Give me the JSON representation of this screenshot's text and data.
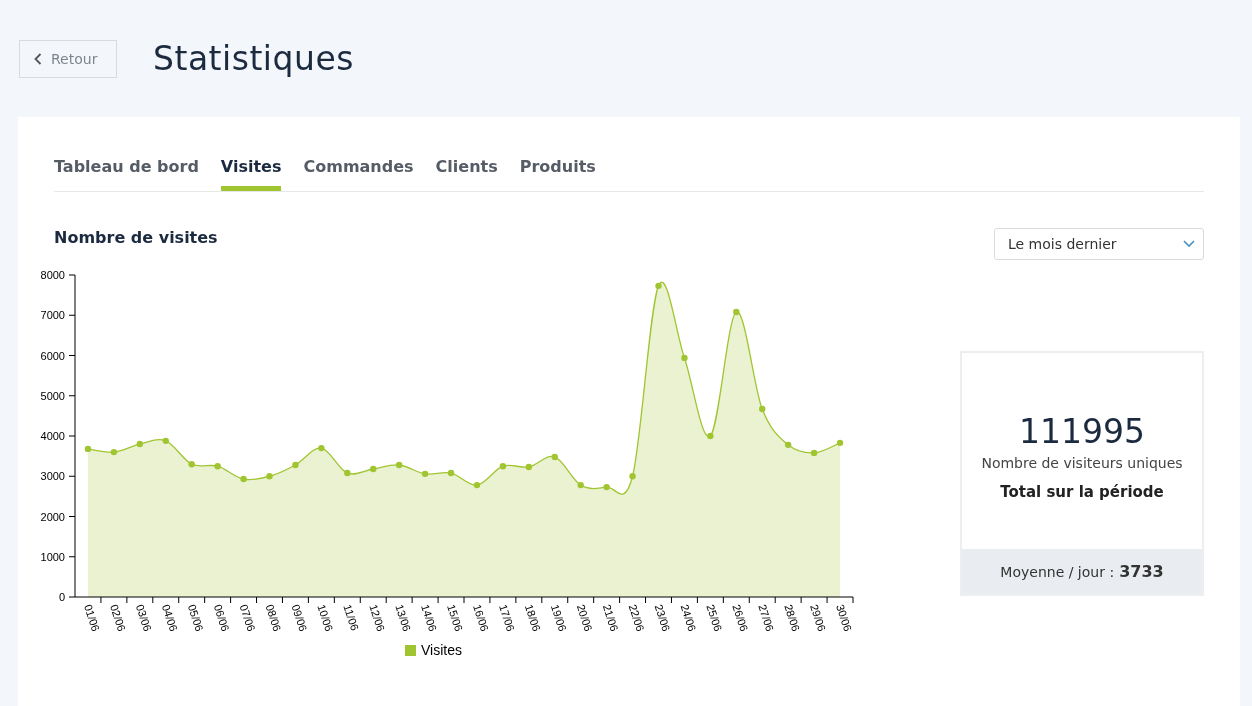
{
  "header": {
    "back_button": "Retour",
    "title": "Statistiques"
  },
  "tabs": [
    {
      "label": "Tableau de bord",
      "selected": false
    },
    {
      "label": "Visites",
      "selected": true
    },
    {
      "label": "Commandes",
      "selected": false
    },
    {
      "label": "Clients",
      "selected": false
    },
    {
      "label": "Produits",
      "selected": false
    }
  ],
  "section_title": "Nombre de visites",
  "period_select": {
    "value": "Le mois dernier"
  },
  "chart_data": {
    "type": "area",
    "categories": [
      "01/06",
      "02/06",
      "03/06",
      "04/06",
      "05/06",
      "06/06",
      "07/06",
      "08/06",
      "09/06",
      "10/06",
      "11/06",
      "12/06",
      "13/06",
      "14/06",
      "15/06",
      "16/06",
      "17/06",
      "18/06",
      "19/06",
      "20/06",
      "21/06",
      "22/06",
      "23/06",
      "24/06",
      "25/06",
      "26/06",
      "27/06",
      "28/06",
      "29/06",
      "30/06"
    ],
    "series": [
      {
        "name": "Visites",
        "color": "#a0c531",
        "values": [
          3680,
          3600,
          3800,
          3880,
          3300,
          3250,
          2930,
          3000,
          3280,
          3700,
          3080,
          3180,
          3280,
          3060,
          3080,
          2780,
          3250,
          3230,
          3480,
          2780,
          2730,
          3000,
          7730,
          5940,
          4000,
          7080,
          4670,
          3780,
          3580,
          3830
        ]
      }
    ],
    "ylim": [
      0,
      8000
    ],
    "yticks": [
      0,
      1000,
      2000,
      3000,
      4000,
      5000,
      6000,
      7000,
      8000
    ]
  },
  "summary": {
    "total": "111995",
    "total_label": "Nombre de visiteurs uniques",
    "period_label": "Total sur la période",
    "average_label": "Moyenne / jour :",
    "average": "3733"
  }
}
